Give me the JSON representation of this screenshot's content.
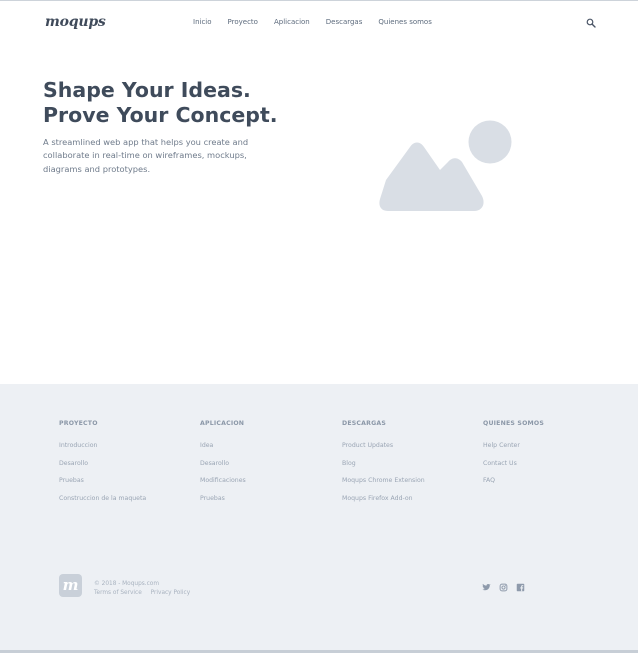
{
  "header": {
    "logo": "moqups",
    "nav": [
      "Inicio",
      "Proyecto",
      "Aplicacion",
      "Descargas",
      "Quienes somos"
    ]
  },
  "hero": {
    "title_line1": "Shape Your Ideas.",
    "title_line2": "Prove Your Concept.",
    "subtitle": "A streamlined web app that helps you create and collaborate in real-time on wireframes, mockups, diagrams and prototypes."
  },
  "footer": {
    "columns": [
      {
        "title": "PROYECTO",
        "links": [
          "Introduccion",
          "Desarollo",
          "Pruebas",
          "Construccion de la maqueta"
        ]
      },
      {
        "title": "APLICACION",
        "links": [
          "Idea",
          "Desarollo",
          "Modificaciones",
          "Pruebas"
        ]
      },
      {
        "title": "DESCARGAS",
        "links": [
          "Product Updates",
          "Blog",
          "Moqups Chrome Extension",
          "Moqups Firefox Add-on"
        ]
      },
      {
        "title": "QUIENES SOMOS",
        "links": [
          "Help Center",
          "Contact Us",
          "FAQ"
        ]
      }
    ],
    "logo_letter": "m",
    "copyright": "© 2018 - Moqups.com",
    "terms": "Terms of Service",
    "privacy": "Privacy Policy"
  },
  "icons": {
    "search": "search-icon",
    "twitter": "twitter-icon",
    "instagram": "instagram-icon",
    "facebook": "facebook-icon",
    "image_placeholder": "image-placeholder-icon"
  },
  "colors": {
    "heading": "#3f4b5b",
    "footer_bg": "#edf0f4",
    "placeholder": "#d9dee5"
  }
}
